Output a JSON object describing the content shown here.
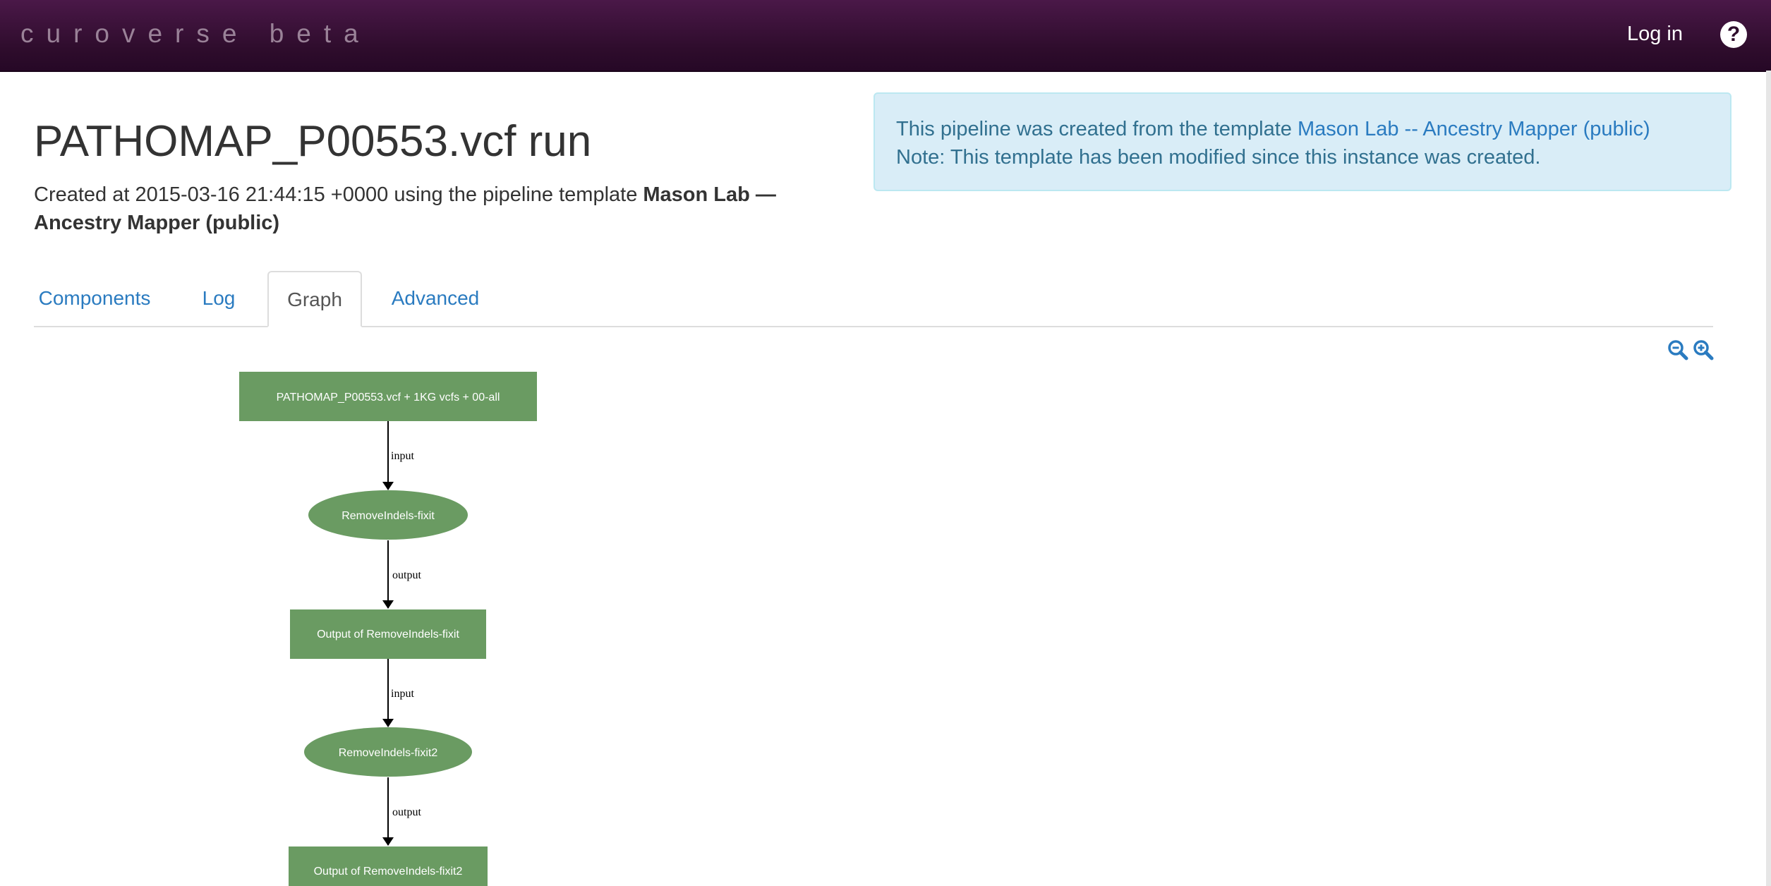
{
  "navbar": {
    "brand": "curoverse beta",
    "login_label": "Log in",
    "help_icon": "question-circle-icon"
  },
  "page": {
    "title": "PATHOMAP_P00553.vcf run",
    "created_prefix": "Created at 2015-03-16 21:44:15 +0000 using the pipeline template ",
    "template_name": "Mason Lab — Ancestry Mapper (public)"
  },
  "alert": {
    "line1_prefix": "This pipeline was created from the template ",
    "line1_link": "Mason Lab -- Ancestry Mapper (public)",
    "line2": "Note: This template has been modified since this instance was created."
  },
  "tabs": [
    {
      "label": "Components",
      "active": false
    },
    {
      "label": "Log",
      "active": false
    },
    {
      "label": "Graph",
      "active": true
    },
    {
      "label": "Advanced",
      "active": false
    }
  ],
  "zoom": {
    "out_icon": "zoom-out-icon",
    "in_icon": "zoom-in-icon"
  },
  "colors": {
    "node": "#6a9b62",
    "accent": "#2a7bc0",
    "navbar": "#2e0c2c"
  },
  "graph": {
    "nodes": [
      {
        "label": "PATHOMAP_P00553.vcf  + 1KG vcfs + 00-all",
        "shape": "box"
      },
      {
        "label": "RemoveIndels-fixit",
        "shape": "ellipse"
      },
      {
        "label": "Output of RemoveIndels-fixit",
        "shape": "box"
      },
      {
        "label": "RemoveIndels-fixit2",
        "shape": "ellipse"
      },
      {
        "label": "Output of RemoveIndels-fixit2",
        "shape": "box"
      }
    ],
    "edges": [
      {
        "label": "input"
      },
      {
        "label": "output"
      },
      {
        "label": "input"
      },
      {
        "label": "output"
      }
    ]
  }
}
